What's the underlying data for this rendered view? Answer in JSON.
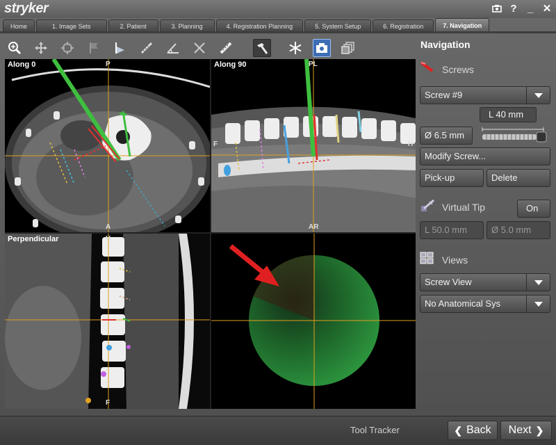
{
  "app": {
    "brand": "stryker"
  },
  "window_controls": [
    {
      "name": "camera-icon",
      "glyph": "▣"
    },
    {
      "name": "help-icon",
      "glyph": "?"
    },
    {
      "name": "minimize-icon",
      "glyph": "_"
    },
    {
      "name": "close-icon",
      "glyph": "✕"
    }
  ],
  "tabs": [
    {
      "label": "Home",
      "active": false
    },
    {
      "label": "1. Image Sets",
      "active": false
    },
    {
      "label": "2. Patient",
      "active": false
    },
    {
      "label": "3. Planning",
      "active": false
    },
    {
      "label": "4. Registration Planning",
      "active": false
    },
    {
      "label": "5. System Setup",
      "active": false
    },
    {
      "label": "6. Registration",
      "active": false
    },
    {
      "label": "7. Navigation",
      "active": true
    }
  ],
  "toolbar": [
    {
      "icon": "zoom-icon"
    },
    {
      "icon": "pan-icon"
    },
    {
      "icon": "rotate-icon"
    },
    {
      "icon": "flag-icon"
    },
    {
      "icon": "pointer-icon"
    },
    {
      "icon": "screw-icon"
    },
    {
      "icon": "angle-icon"
    },
    {
      "icon": "cross-measure-icon"
    },
    {
      "icon": "ruler-icon"
    },
    {
      "icon": "hammer-icon",
      "state": "pressed"
    },
    {
      "icon": "snowflake-icon"
    },
    {
      "icon": "snapshot-icon",
      "state": "toggled"
    },
    {
      "icon": "layers-icon"
    }
  ],
  "viewports": {
    "along0": {
      "label": "Along 0",
      "top": "P",
      "bottom": "A"
    },
    "along90": {
      "label": "Along 90",
      "top": "PL",
      "bottom": "AR",
      "left": "F",
      "right": "H"
    },
    "perpendicular": {
      "label": "Perpendicular",
      "top": "H",
      "bottom": "F"
    },
    "probe_view": {
      "label": ""
    }
  },
  "navigation": {
    "title": "Navigation",
    "screws": {
      "label": "Screws",
      "selected": "Screw #9",
      "length": "L 40 mm",
      "diameter": "Ø 6.5 mm",
      "modify": "Modify Screw...",
      "pickup": "Pick-up",
      "delete": "Delete"
    },
    "virtual_tip": {
      "label": "Virtual Tip",
      "toggle": "On",
      "length": "L 50.0 mm",
      "diameter": "Ø 5.0 mm"
    },
    "views": {
      "label": "Views",
      "view_select": "Screw View",
      "anatomical_select": "No Anatomical Sys"
    }
  },
  "footer": {
    "status": "Tool Tracker",
    "back": "Back",
    "next": "Next"
  },
  "colors": {
    "trajectory": "#3fbf3f",
    "crosshair": "#e0a020",
    "arrow": "#e02020",
    "target_disc": "#1f8f3a"
  }
}
